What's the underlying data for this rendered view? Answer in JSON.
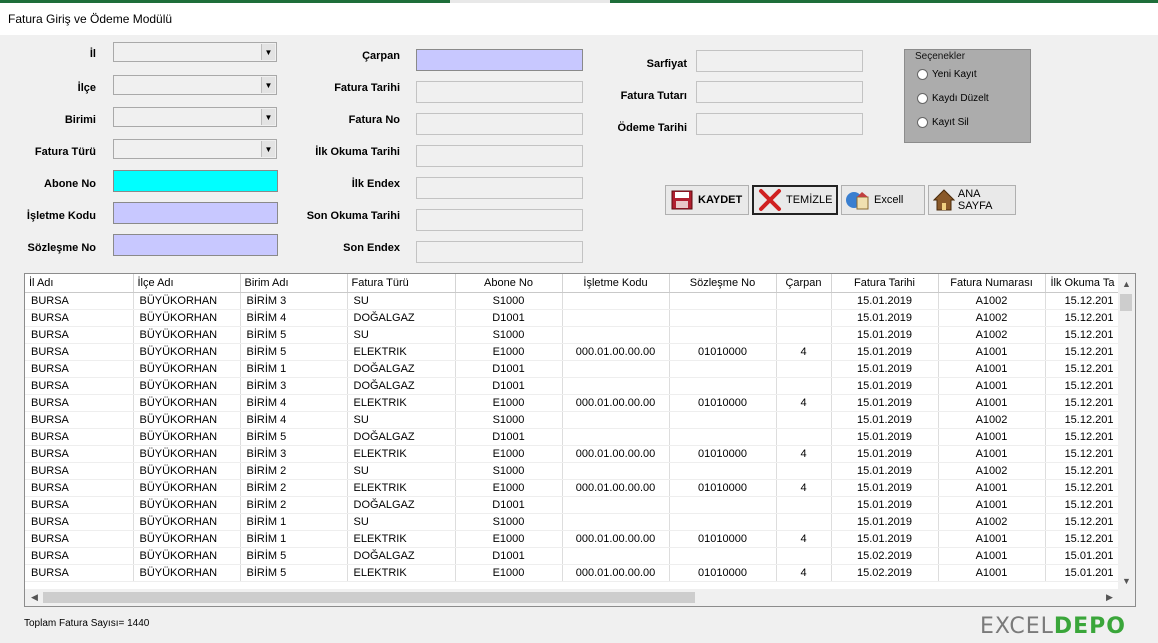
{
  "window": {
    "title": "Fatura Giriş ve Ödeme Modülü"
  },
  "form": {
    "il_label": "İl",
    "ilce_label": "İlçe",
    "birimi_label": "Birimi",
    "fatura_turu_label": "Fatura Türü",
    "abone_no_label": "Abone No",
    "isletme_kodu_label": "İşletme Kodu",
    "sozlesme_no_label": "Sözleşme No",
    "carpan_label": "Çarpan",
    "fatura_tarihi_label": "Fatura Tarihi",
    "fatura_no_label": "Fatura No",
    "ilk_okuma_tarihi_label": "İlk Okuma Tarihi",
    "ilk_endex_label": "İlk Endex",
    "son_okuma_tarihi_label": "Son Okuma Tarihi",
    "son_endex_label": "Son Endex",
    "sarfiyat_label": "Sarfiyat",
    "fatura_tutari_label": "Fatura Tutarı",
    "odeme_tarihi_label": "Ödeme Tarihi"
  },
  "options": {
    "title": "Seçenekler",
    "yeni_kayit": "Yeni Kayıt",
    "kaydi_duzelt": "Kaydı Düzelt",
    "kayit_sil": "Kayıt Sil"
  },
  "buttons": {
    "kaydet": "KAYDET",
    "temizle": "TEMİZLE",
    "excel": "Excell",
    "ana_sayfa": "ANA SAYFA"
  },
  "colors": {
    "abone_no_bg": "#00ffff",
    "lavender_bg": "#c8c8ff"
  },
  "grid": {
    "columns": [
      "İl Adı",
      "İlçe Adı",
      "Birim Adı",
      "Fatura Türü",
      "Abone No",
      "İşletme Kodu",
      "Sözleşme No",
      "Çarpan",
      "Fatura Tarihi",
      "Fatura Numarası",
      "İlk Okuma Ta"
    ],
    "rows": [
      [
        "BURSA",
        "BÜYÜKORHAN",
        "BİRİM 3",
        "SU",
        "S1000",
        "",
        "",
        "",
        "15.01.2019",
        "A1002",
        "15.12.201"
      ],
      [
        "BURSA",
        "BÜYÜKORHAN",
        "BİRİM 4",
        "DOĞALGAZ",
        "D1001",
        "",
        "",
        "",
        "15.01.2019",
        "A1002",
        "15.12.201"
      ],
      [
        "BURSA",
        "BÜYÜKORHAN",
        "BİRİM 5",
        "SU",
        "S1000",
        "",
        "",
        "",
        "15.01.2019",
        "A1002",
        "15.12.201"
      ],
      [
        "BURSA",
        "BÜYÜKORHAN",
        "BİRİM 5",
        "ELEKTRIK",
        "E1000",
        "000.01.00.00.00",
        "01010000",
        "4",
        "15.01.2019",
        "A1001",
        "15.12.201"
      ],
      [
        "BURSA",
        "BÜYÜKORHAN",
        "BİRİM 1",
        "DOĞALGAZ",
        "D1001",
        "",
        "",
        "",
        "15.01.2019",
        "A1001",
        "15.12.201"
      ],
      [
        "BURSA",
        "BÜYÜKORHAN",
        "BİRİM 3",
        "DOĞALGAZ",
        "D1001",
        "",
        "",
        "",
        "15.01.2019",
        "A1001",
        "15.12.201"
      ],
      [
        "BURSA",
        "BÜYÜKORHAN",
        "BİRİM 4",
        "ELEKTRIK",
        "E1000",
        "000.01.00.00.00",
        "01010000",
        "4",
        "15.01.2019",
        "A1001",
        "15.12.201"
      ],
      [
        "BURSA",
        "BÜYÜKORHAN",
        "BİRİM 4",
        "SU",
        "S1000",
        "",
        "",
        "",
        "15.01.2019",
        "A1002",
        "15.12.201"
      ],
      [
        "BURSA",
        "BÜYÜKORHAN",
        "BİRİM 5",
        "DOĞALGAZ",
        "D1001",
        "",
        "",
        "",
        "15.01.2019",
        "A1001",
        "15.12.201"
      ],
      [
        "BURSA",
        "BÜYÜKORHAN",
        "BİRİM 3",
        "ELEKTRIK",
        "E1000",
        "000.01.00.00.00",
        "01010000",
        "4",
        "15.01.2019",
        "A1001",
        "15.12.201"
      ],
      [
        "BURSA",
        "BÜYÜKORHAN",
        "BİRİM 2",
        "SU",
        "S1000",
        "",
        "",
        "",
        "15.01.2019",
        "A1002",
        "15.12.201"
      ],
      [
        "BURSA",
        "BÜYÜKORHAN",
        "BİRİM 2",
        "ELEKTRIK",
        "E1000",
        "000.01.00.00.00",
        "01010000",
        "4",
        "15.01.2019",
        "A1001",
        "15.12.201"
      ],
      [
        "BURSA",
        "BÜYÜKORHAN",
        "BİRİM 2",
        "DOĞALGAZ",
        "D1001",
        "",
        "",
        "",
        "15.01.2019",
        "A1001",
        "15.12.201"
      ],
      [
        "BURSA",
        "BÜYÜKORHAN",
        "BİRİM 1",
        "SU",
        "S1000",
        "",
        "",
        "",
        "15.01.2019",
        "A1002",
        "15.12.201"
      ],
      [
        "BURSA",
        "BÜYÜKORHAN",
        "BİRİM 1",
        "ELEKTRIK",
        "E1000",
        "000.01.00.00.00",
        "01010000",
        "4",
        "15.01.2019",
        "A1001",
        "15.12.201"
      ],
      [
        "BURSA",
        "BÜYÜKORHAN",
        "BİRİM 5",
        "DOĞALGAZ",
        "D1001",
        "",
        "",
        "",
        "15.02.2019",
        "A1001",
        "15.01.201"
      ],
      [
        "BURSA",
        "BÜYÜKORHAN",
        "BİRİM 5",
        "ELEKTRIK",
        "E1000",
        "000.01.00.00.00",
        "01010000",
        "4",
        "15.02.2019",
        "A1001",
        "15.01.201"
      ]
    ]
  },
  "status": {
    "total_label": "Toplam Fatura Sayısı= 1440"
  },
  "watermark": {
    "text_left": "EXCEL",
    "text_right": "DEPO"
  }
}
